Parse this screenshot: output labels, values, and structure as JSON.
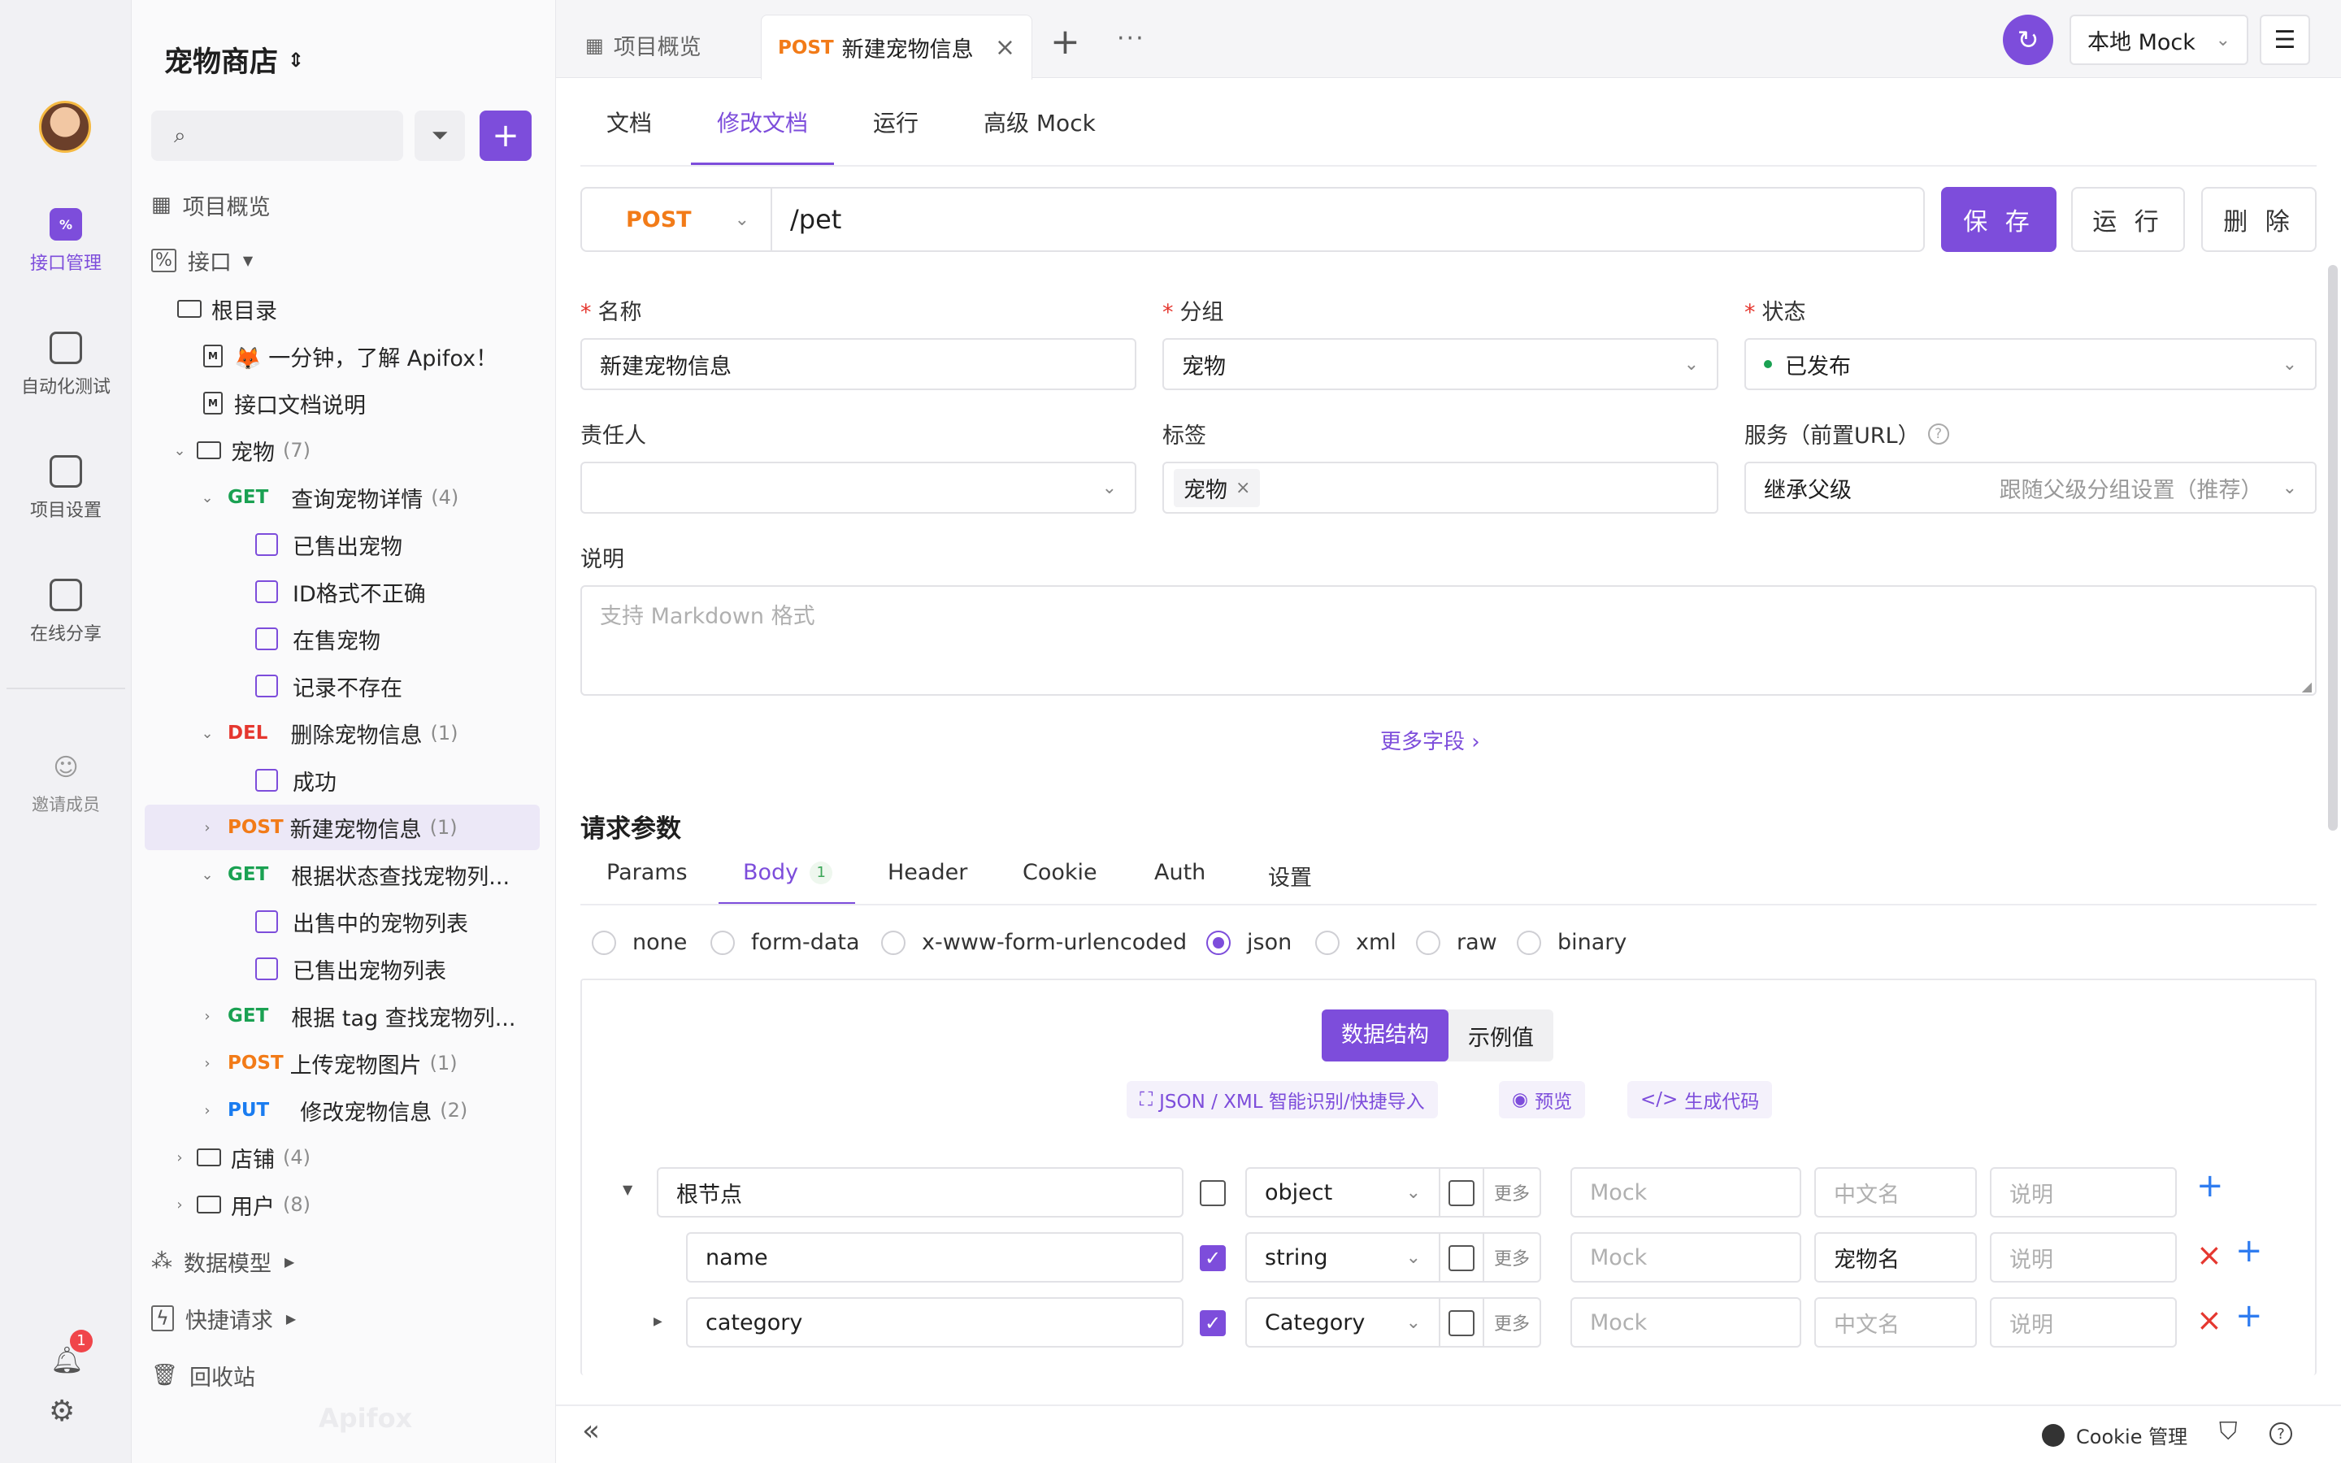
{
  "window": {
    "dot_colors": [
      "#fe5f57",
      "#febc2e",
      "#28c840"
    ]
  },
  "rail": {
    "items": [
      {
        "label": "接口管理",
        "icon": "api-icon"
      },
      {
        "label": "自动化测试",
        "icon": "automation-icon"
      },
      {
        "label": "项目设置",
        "icon": "settings-icon"
      },
      {
        "label": "在线分享",
        "icon": "share-icon"
      },
      {
        "label": "邀请成员",
        "icon": "invite-icon"
      }
    ],
    "notification_badge": "1"
  },
  "sidebar": {
    "project_name": "宠物商店",
    "overview": "项目概览",
    "interfaces": "接口",
    "root": "根目录",
    "docs": [
      "🦊 一分钟，了解 Apifox！",
      "接口文档说明"
    ],
    "pet_folder": {
      "name": "宠物",
      "count": "(7)"
    },
    "endpoints": [
      {
        "method": "GET",
        "name": "查询宠物详情",
        "count": "(4)",
        "cases": [
          "已售出宠物",
          "ID格式不正确",
          "在售宠物",
          "记录不存在"
        ]
      },
      {
        "method": "DEL",
        "name": "删除宠物信息",
        "count": "(1)",
        "cases": [
          "成功"
        ]
      },
      {
        "method": "POST",
        "name": "新建宠物信息",
        "count": "(1)",
        "cases": []
      },
      {
        "method": "GET",
        "name": "根据状态查找宠物列...",
        "count": "",
        "cases": [
          "出售中的宠物列表",
          "已售出宠物列表"
        ]
      },
      {
        "method": "GET",
        "name": "根据 tag 查找宠物列...",
        "count": "",
        "cases": []
      },
      {
        "method": "POST",
        "name": "上传宠物图片",
        "count": "(1)",
        "cases": []
      },
      {
        "method": "PUT",
        "name": "修改宠物信息",
        "count": "(2)",
        "cases": []
      }
    ],
    "folders": [
      {
        "name": "店铺",
        "count": "(4)"
      },
      {
        "name": "用户",
        "count": "(8)"
      }
    ],
    "bottom": [
      "数据模型",
      "快捷请求",
      "回收站"
    ],
    "watermark": "Apifox"
  },
  "tabs": {
    "overview": "项目概览",
    "active_method": "POST",
    "active_title": "新建宠物信息",
    "env": "本地 Mock"
  },
  "subtabs": [
    "文档",
    "修改文档",
    "运行",
    "高级 Mock"
  ],
  "request": {
    "method": "POST",
    "path": "/pet",
    "save": "保 存",
    "run": "运 行",
    "delete": "删 除"
  },
  "form": {
    "name_label": "名称",
    "name_value": "新建宠物信息",
    "group_label": "分组",
    "group_value": "宠物",
    "status_label": "状态",
    "status_value": "已发布",
    "owner_label": "责任人",
    "tags_label": "标签",
    "tag_value": "宠物",
    "service_label": "服务（前置URL）",
    "service_value": "继承父级",
    "service_hint": "跟随父级分组设置（推荐）",
    "desc_label": "说明",
    "desc_placeholder": "支持 Markdown 格式",
    "more_fields": "更多字段 ›"
  },
  "params": {
    "title": "请求参数",
    "tabs": [
      "Params",
      "Body",
      "Header",
      "Cookie",
      "Auth",
      "设置"
    ],
    "body_count": "1",
    "body_types": [
      "none",
      "form-data",
      "x-www-form-urlencoded",
      "json",
      "xml",
      "raw",
      "binary"
    ],
    "selected_type": "json",
    "schema_tab": "数据结构",
    "example_tab": "示例值",
    "actions": [
      "JSON / XML 智能识别/快捷导入",
      "预览",
      "生成代码"
    ],
    "rows": [
      {
        "name": "根节点",
        "type": "object",
        "more": "更多",
        "mock": "Mock",
        "cn": "中文名",
        "desc": "说明",
        "checked": false
      },
      {
        "name": "name",
        "type": "string",
        "more": "更多",
        "mock": "Mock",
        "cn": "宠物名",
        "desc": "说明",
        "checked": true
      },
      {
        "name": "category",
        "type": "Category",
        "more": "更多",
        "mock": "Mock",
        "cn": "中文名",
        "desc": "说明",
        "checked": true
      }
    ]
  },
  "footer": {
    "cookie": "Cookie 管理"
  },
  "colors": {
    "accent": "#7d4ddb",
    "get": "#1aa152",
    "post": "#f27b18",
    "del": "#e5372f",
    "put": "#1a7cf0"
  }
}
